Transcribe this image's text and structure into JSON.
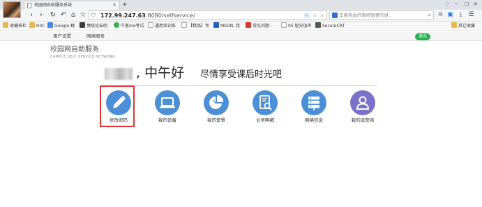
{
  "browser": {
    "tab_title": "校园网自助服务系统",
    "url_host": "172.99.247.63",
    "url_rest": ":8080/selfservice/",
    "search_placeholder": "华春热血的周婷就要灭妖"
  },
  "bookmarks": [
    {
      "label": "收藏夹栏",
      "color": "#e8b84a"
    },
    {
      "label": "H3C",
      "color": "#e8b84a"
    },
    {
      "label": "Google 翻",
      "color": "#4a86e8"
    },
    {
      "label": "博晓论坛吧",
      "color": "#3a3a3a"
    },
    {
      "label": "牛客me考试",
      "color": "#3fae49"
    },
    {
      "label": "通用培训系",
      "color": "#d9d9d9"
    },
    {
      "label": "【精品】考",
      "color": "#d9d9d9"
    },
    {
      "label": "MSDN, 我",
      "color": "#1f5fbf"
    },
    {
      "label": "常见问题 -",
      "color": "#d23a2a"
    },
    {
      "label": "05 智分加声",
      "color": "#d9d9d9"
    },
    {
      "label": "SecureCRT",
      "color": "#555555"
    },
    {
      "label": "其它收藏",
      "color": "#e8b84a"
    }
  ],
  "topnav": {
    "user_settings": "用户设置",
    "net_service": "网络服务",
    "logout": "退出"
  },
  "header": {
    "title": "校园网自助服务",
    "subtitle": "CAMPUS SELF-SERVICE NETWORK",
    "greeting": ", 中午好",
    "tagline": "尽情享受课后时光吧"
  },
  "services": [
    {
      "label": "修改密码",
      "icon": "pencil-icon",
      "color": "#4c8fd6"
    },
    {
      "label": "我的设备",
      "icon": "laptop-icon",
      "color": "#4c8fd6"
    },
    {
      "label": "我的套餐",
      "icon": "pie-chart-icon",
      "color": "#4c8fd6"
    },
    {
      "label": "业务明细",
      "icon": "document-search-icon",
      "color": "#4c8fd6"
    },
    {
      "label": "网络信息",
      "icon": "server-icon",
      "color": "#4c8fd6"
    },
    {
      "label": "我的运营商",
      "icon": "user-icon",
      "color": "#7a72c9"
    }
  ],
  "colors": {
    "accent": "#4c8fd6",
    "logout_green": "#27b04f",
    "highlight_red": "#e23030"
  }
}
